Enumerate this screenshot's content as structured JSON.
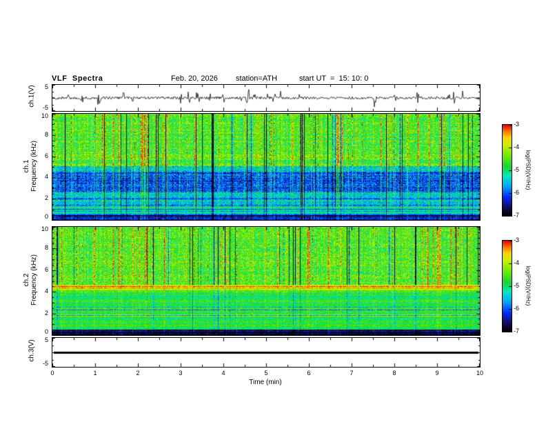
{
  "header": {
    "title": "VLF  Spectra",
    "date": "Feb. 20, 2026",
    "station": "station=ATH",
    "start_ut": "start UT  =  15: 10: 0"
  },
  "panels": {
    "ch1_wave": {
      "ylabel": "ch.1(V)",
      "ymax_label": "5",
      "ymin_label": "-5"
    },
    "ch1_spec": {
      "ylabel_line1": "ch.1",
      "ylabel_line2": "Frequency (kHz)",
      "yticks": [
        "10",
        "8",
        "6",
        "4",
        "2",
        "0"
      ]
    },
    "ch2_spec": {
      "ylabel_line1": "ch.2",
      "ylabel_line2": "Frequency (kHz)",
      "yticks": [
        "10",
        "8",
        "6",
        "4",
        "2",
        "0"
      ]
    },
    "ch3_wave": {
      "ylabel": "ch.3(V)",
      "ymax_label": "5",
      "ymin_label": "-5"
    }
  },
  "xaxis": {
    "label": "Time (min)",
    "ticks": [
      "0",
      "1",
      "2",
      "3",
      "4",
      "5",
      "6",
      "7",
      "8",
      "9",
      "10"
    ]
  },
  "colorbar": {
    "label": "log(PSD)(V²/Hz)",
    "ticks": [
      "-3",
      "-4",
      "-5",
      "-6",
      "-7"
    ]
  },
  "chart_data": [
    {
      "type": "line",
      "panel": "ch.1 waveform",
      "ylabel": "ch.1(V)",
      "y_range": [
        -5,
        5
      ],
      "x_range_min": [
        0,
        10
      ],
      "description": "Dense noisy voltage trace centered near 0 V with frequent impulsive sferic spikes reaching roughly ±2 to ±4 V across the full 10 minutes"
    },
    {
      "type": "heatmap",
      "panel": "ch.1 spectrogram",
      "ylabel": "ch.1 Frequency (kHz)",
      "y_range_khz": [
        0,
        10
      ],
      "x_range_min": [
        0,
        10
      ],
      "colorbar_label": "log(PSD)(V²/Hz)",
      "color_range": [
        -7,
        -3
      ],
      "colormap": "rainbow: black-blue-cyan-green-yellow-orange-red",
      "description": "Broadband green/yellow PSD (~-4.5) above ~5 kHz with dense vertical sferic streaks (bright yellow/red and dark/black columns), a low-PSD blue band (~-6) from ~2.5 to 5 kHz, cyan/green mottle from ~1 to 2.5 kHz, dark rows near 0.5-1 kHz and a dark band near 0-0.5 kHz"
    },
    {
      "type": "heatmap",
      "panel": "ch.2 spectrogram",
      "ylabel": "ch.2 Frequency (kHz)",
      "y_range_khz": [
        0,
        10
      ],
      "x_range_min": [
        0,
        10
      ],
      "colorbar_label": "log(PSD)(V²/Hz)",
      "color_range": [
        -7,
        -3
      ],
      "colormap": "rainbow: black-blue-cyan-green-yellow-orange-red",
      "description": "Streaked green/yellow PSD above ~4.7 kHz similar to ch.1, a bright yellow horizontal band near 4.2-4.7 kHz, smoother green region with fine yellow and dark horizontal striations from ~0.5 to 4.2 kHz, dark/black band near 0-0.5 kHz"
    },
    {
      "type": "line",
      "panel": "ch.3 waveform",
      "ylabel": "ch.3(V)",
      "y_range": [
        -5,
        5
      ],
      "x_range_min": [
        0,
        10
      ],
      "description": "Flat thick black trace at approximately 0 V (inactive channel)"
    }
  ]
}
